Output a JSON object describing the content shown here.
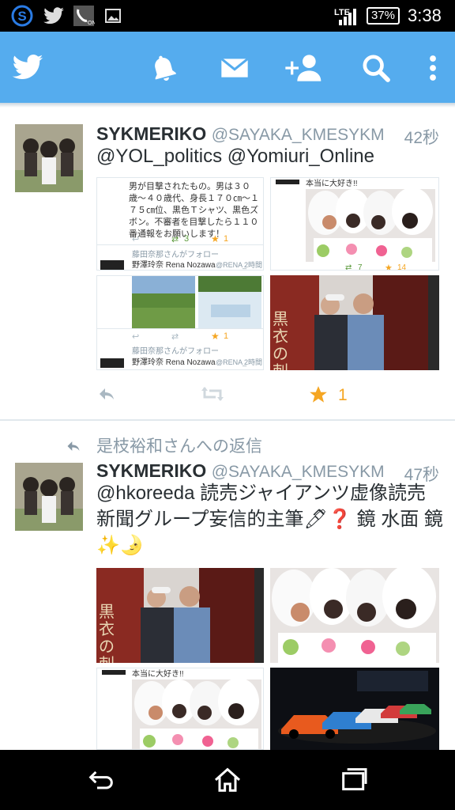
{
  "status_bar": {
    "network": "LTE",
    "battery": "37%",
    "time": "3:38"
  },
  "colors": {
    "twitter_blue": "#55acee",
    "star_orange": "#f5a623",
    "muted": "#8899a6"
  },
  "tweet1": {
    "name": "SYKMERIKO",
    "handle": "@SAYAKA_KMESYKM",
    "time": "42秒",
    "text": "@YOL_politics @Yomiuri_Online",
    "embedded": {
      "post_text": "男が目撃されたもの。男は３０歳〜４０歳代、身長１７０㎝〜１７５㎝位、黒色Ｔシャツ、黒色ズボン。不審者を目撃したら１１０番通報をお願いします！",
      "retweets": "3",
      "favorites": "1",
      "follow_note": "藤田奈那さんがフォロー",
      "user_name": "野澤玲奈 Rena Nozawa",
      "user_handle": "@RENA_",
      "time_ago": "2時間",
      "favorites_2": "1",
      "follow_note_2": "藤田奈那さんがフォロー",
      "user_name_2": "野澤玲奈 Rena Nozawa",
      "user_handle_2": "@RENA_",
      "time_ago_2": "2時間",
      "caption": "本当に大好き!!",
      "r_retweets": "7",
      "r_favorites": "14",
      "poster_text": "黒衣の刺"
    },
    "favorite_count": "1"
  },
  "tweet2": {
    "reply_context": "是枝裕和さんへの返信",
    "name": "SYKMERIKO",
    "handle": "@SAYAKA_KMESYKM",
    "time": "47秒",
    "text": "@hkoreeda 読売ジャイアンツ虚像読売新聞グループ妄信的主筆🖊❓ 鏡 水面 鏡 ✨🌛",
    "poster_text": "黒衣の刺",
    "caption": "本当に大好き!!"
  }
}
